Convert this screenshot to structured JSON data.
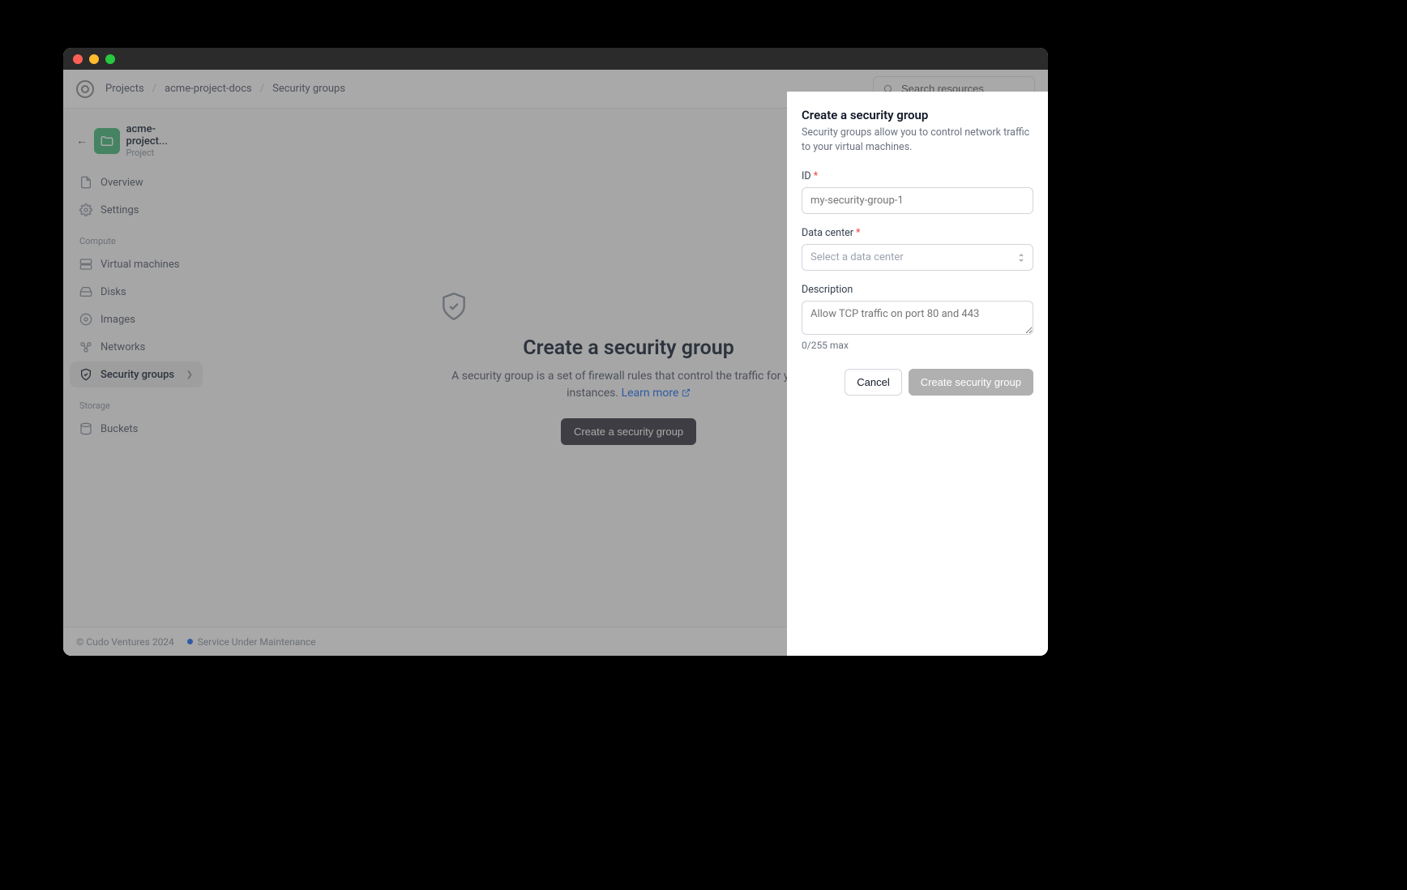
{
  "breadcrumbs": [
    "Projects",
    "acme-project-docs",
    "Security groups"
  ],
  "search": {
    "placeholder": "Search resources"
  },
  "project": {
    "name": "acme-project...",
    "type": "Project"
  },
  "sidebar": {
    "items_top": [
      {
        "label": "Overview",
        "icon": "file-icon"
      },
      {
        "label": "Settings",
        "icon": "gear-icon"
      }
    ],
    "sections": [
      {
        "title": "Compute",
        "items": [
          {
            "label": "Virtual machines",
            "icon": "server-icon"
          },
          {
            "label": "Disks",
            "icon": "disk-icon"
          },
          {
            "label": "Images",
            "icon": "image-icon"
          },
          {
            "label": "Networks",
            "icon": "network-icon"
          },
          {
            "label": "Security groups",
            "icon": "shield-icon",
            "active": true
          }
        ]
      },
      {
        "title": "Storage",
        "items": [
          {
            "label": "Buckets",
            "icon": "bucket-icon"
          }
        ]
      }
    ]
  },
  "empty": {
    "title": "Create a security group",
    "description_pre": "A security group is a set of firewall rules that control the traffic for your instances. ",
    "learn_more": "Learn more",
    "button": "Create a security group"
  },
  "footer": {
    "copyright": "© Cudo Ventures 2024",
    "status": "Service Under Maintenance"
  },
  "panel": {
    "title": "Create a security group",
    "description": "Security groups allow you to control network traffic to your virtual machines.",
    "id_label": "ID",
    "id_placeholder": "my-security-group-1",
    "dc_label": "Data center",
    "dc_placeholder": "Select a data center",
    "desc_label": "Description",
    "desc_placeholder": "Allow TCP traffic on port 80 and 443",
    "counter": "0/255 max",
    "cancel": "Cancel",
    "submit": "Create security group"
  }
}
